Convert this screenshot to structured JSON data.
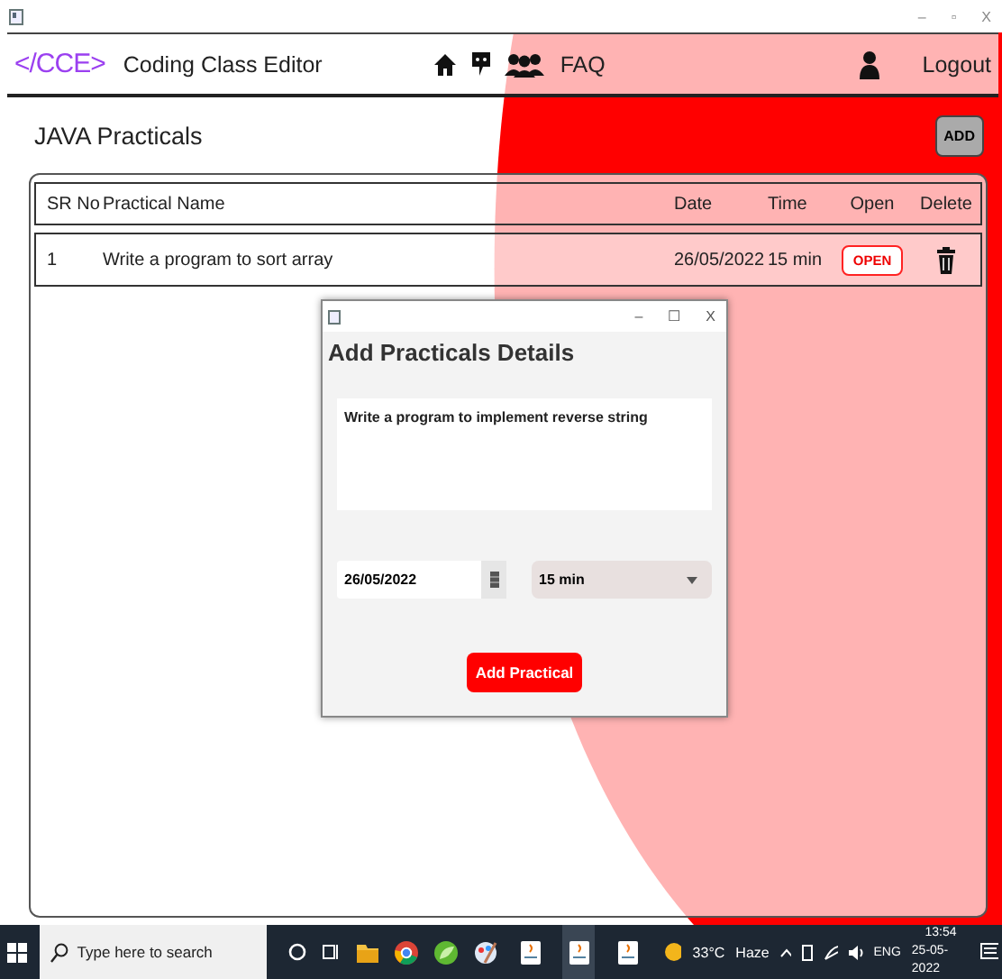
{
  "window": {
    "controls": [
      "–",
      "▫",
      "X"
    ]
  },
  "header": {
    "logo": "</CCE>",
    "title": "Coding Class Editor",
    "nav_link": "FAQ",
    "logout": "Logout"
  },
  "page": {
    "title": "JAVA Practicals",
    "add_button": "ADD"
  },
  "table": {
    "columns": [
      "SR No",
      "Practical Name",
      "Date",
      "Time",
      "Open",
      "Delete"
    ],
    "rows": [
      {
        "sr": "1",
        "name": "Write a program to sort array",
        "date": "26/05/2022",
        "time": "15 min",
        "open": "OPEN"
      }
    ]
  },
  "dialog": {
    "controls": [
      "–",
      "☐",
      "X"
    ],
    "title": "Add Practicals Details",
    "description": "Write a program to implement reverse string",
    "date": "26/05/2022",
    "duration": "15 min",
    "submit": "Add Practical"
  },
  "taskbar": {
    "search_placeholder": "Type here to search",
    "temperature": "33°C",
    "weather": "Haze",
    "language": "ENG",
    "time": "13:54",
    "date": "25-05-2022"
  }
}
